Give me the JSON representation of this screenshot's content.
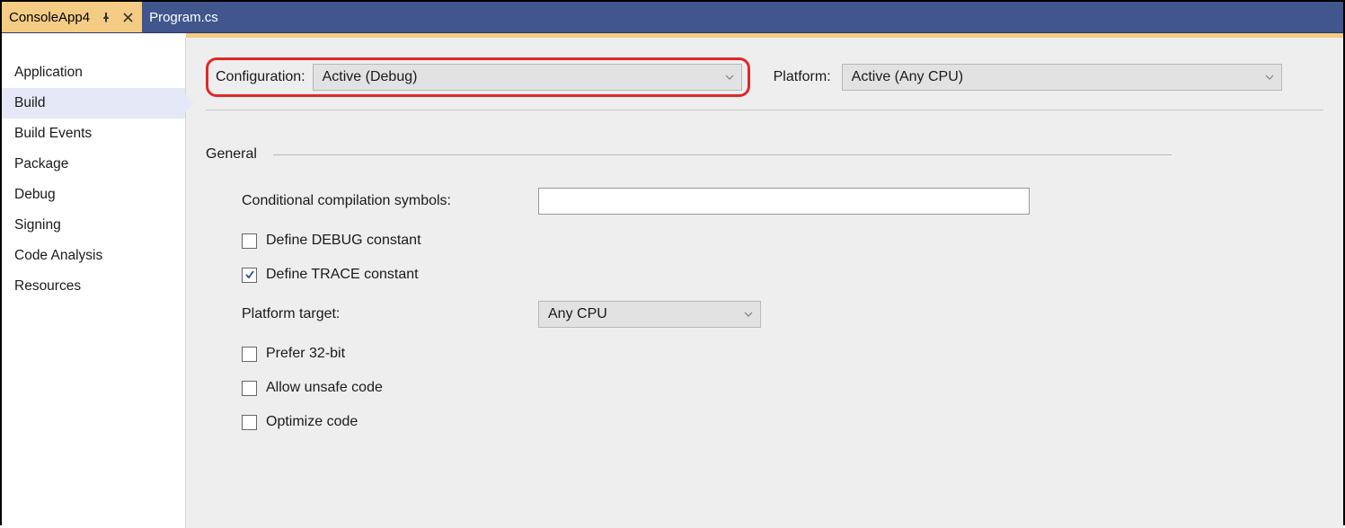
{
  "tabs": [
    {
      "label": "ConsoleApp4",
      "active": true
    },
    {
      "label": "Program.cs",
      "active": false
    }
  ],
  "sidebar": {
    "items": [
      {
        "label": "Application"
      },
      {
        "label": "Build"
      },
      {
        "label": "Build Events"
      },
      {
        "label": "Package"
      },
      {
        "label": "Debug"
      },
      {
        "label": "Signing"
      },
      {
        "label": "Code Analysis"
      },
      {
        "label": "Resources"
      }
    ],
    "selected_index": 1
  },
  "toprow": {
    "configuration_label": "Configuration:",
    "configuration_value": "Active (Debug)",
    "platform_label": "Platform:",
    "platform_value": "Active (Any CPU)"
  },
  "section": {
    "title": "General"
  },
  "fields": {
    "cond_symbols_label": "Conditional compilation symbols:",
    "cond_symbols_value": "",
    "define_debug_label": "Define DEBUG constant",
    "define_debug_checked": false,
    "define_trace_label": "Define TRACE constant",
    "define_trace_checked": true,
    "platform_target_label": "Platform target:",
    "platform_target_value": "Any CPU",
    "prefer_32_label": "Prefer 32-bit",
    "prefer_32_checked": false,
    "allow_unsafe_label": "Allow unsafe code",
    "allow_unsafe_checked": false,
    "optimize_label": "Optimize code",
    "optimize_checked": false
  }
}
